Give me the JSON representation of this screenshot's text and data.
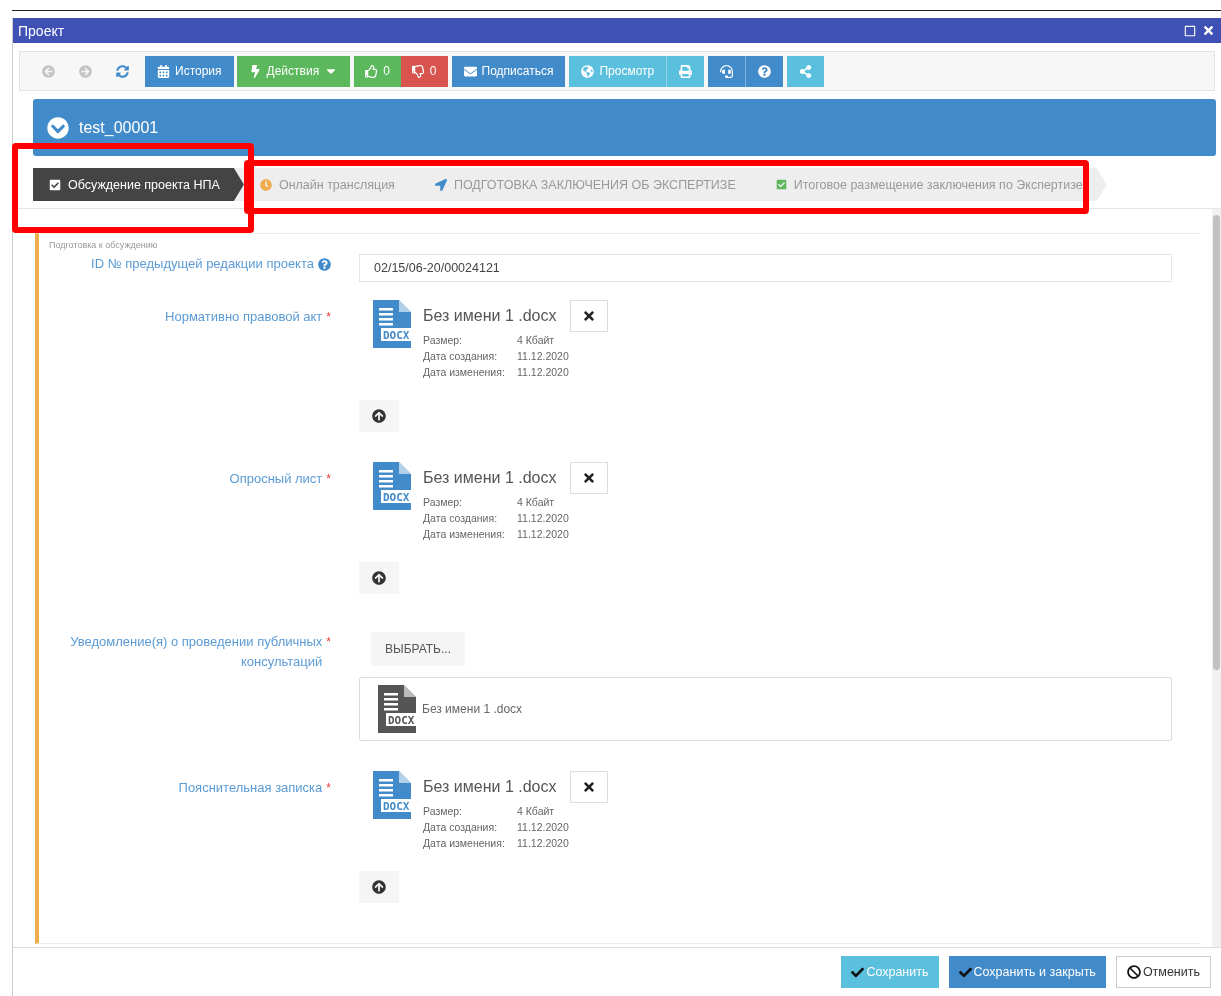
{
  "window": {
    "title": "Проект"
  },
  "toolbar": {
    "buttons": [
      {
        "kind": "back",
        "disabled": true
      },
      {
        "kind": "forward",
        "disabled": true
      },
      {
        "kind": "refresh",
        "disabled": false
      },
      {
        "kind": "history",
        "label": "История"
      },
      {
        "kind": "actions",
        "label": "Действия"
      },
      {
        "kind": "like",
        "label": "0"
      },
      {
        "kind": "dislike",
        "label": "0"
      },
      {
        "kind": "subscribe",
        "label": "Подписаться"
      },
      {
        "kind": "preview",
        "label": "Просмотр"
      },
      {
        "kind": "print"
      },
      {
        "kind": "support"
      },
      {
        "kind": "help"
      },
      {
        "kind": "share"
      }
    ]
  },
  "header": {
    "title": "test_00001"
  },
  "steps": [
    {
      "kind": "draft",
      "label": "Обсуждение проекта НПА",
      "selected": true
    },
    {
      "kind": "waiting",
      "label": "Онлайн трансляция",
      "selected": false
    },
    {
      "kind": "review",
      "label": "ПОДГОТОВКА ЗАКЛЮЧЕНИЯ ОБ ЭКСПЕРТИЗЕ",
      "selected": false
    },
    {
      "kind": "done",
      "label": "Итоговое размещение заключения по Экспертизе",
      "selected": false
    }
  ],
  "form": {
    "section_label": "Подготовка к обсуждению",
    "fields": [
      {
        "kind": "text",
        "label": "ID № предыдущей редакции проекта",
        "help": true,
        "value": "02/15/06-20/00024121"
      },
      {
        "kind": "file",
        "label": "Нормативно правовой акт",
        "required_mark": "*",
        "file": {
          "type_label": "DOCX",
          "name": "Без имени 1 .docx",
          "meta": [
            {
              "label": "Размер:",
              "value": "4 Кбайт"
            },
            {
              "label": "Дата создания:",
              "value": "11.12.2020"
            },
            {
              "label": "Дата изменения:",
              "value": "11.12.2020"
            }
          ]
        }
      },
      {
        "kind": "file",
        "label": "Опросный лист",
        "required_mark": "*",
        "file": {
          "type_label": "DOCX",
          "name": "Без имени 1 .docx",
          "meta": [
            {
              "label": "Размер:",
              "value": "4 Кбайт"
            },
            {
              "label": "Дата создания:",
              "value": "11.12.2020"
            },
            {
              "label": "Дата изменения:",
              "value": "11.12.2020"
            }
          ]
        }
      },
      {
        "kind": "picker",
        "label": "Уведомление(я) о проведении публичных консультаций",
        "required_mark": "*",
        "button": "ВЫБРАТЬ...",
        "file": {
          "type_label": "DOCX",
          "name": "Без имени 1 .docx"
        }
      },
      {
        "kind": "file",
        "label": "Пояснительная записка",
        "required_mark": "*",
        "file": {
          "type_label": "DOCX",
          "name": "Без имени 1 .docx",
          "meta": [
            {
              "label": "Размер:",
              "value": "4 Кбайт"
            },
            {
              "label": "Дата создания:",
              "value": "11.12.2020"
            },
            {
              "label": "Дата изменения:",
              "value": "11.12.2020"
            }
          ]
        }
      }
    ]
  },
  "footer": {
    "buttons": [
      {
        "kind": "save",
        "label": "Сохранить"
      },
      {
        "kind": "save_close",
        "label": "Сохранить и закрыть"
      },
      {
        "kind": "cancel",
        "label": "Отменить"
      }
    ]
  }
}
